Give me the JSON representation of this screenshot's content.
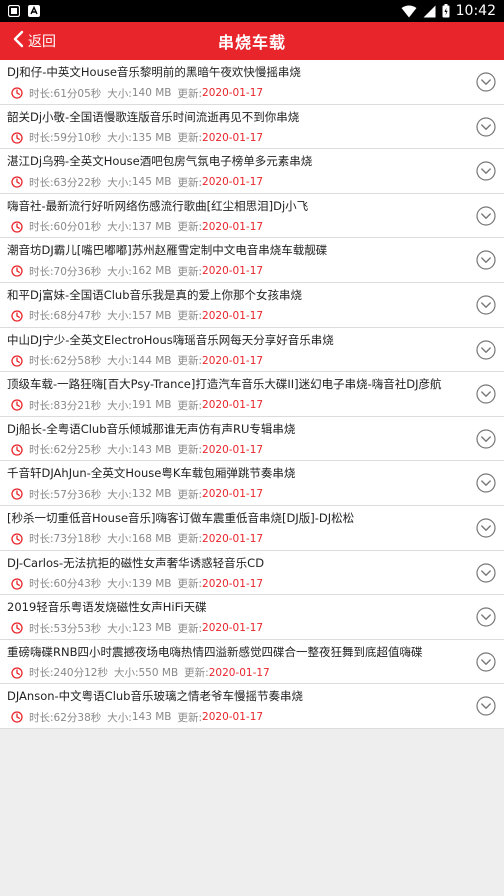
{
  "status": {
    "time": "10:42"
  },
  "header": {
    "back_label": "返回",
    "title": "串烧车载"
  },
  "labels": {
    "duration": "时长:",
    "size": "大小:",
    "updated": "更新:"
  },
  "colors": {
    "accent": "#e8252b"
  },
  "items": [
    {
      "title": "DJ和仔-中英文House音乐黎明前的黑暗午夜欢快慢摇串烧",
      "duration": "61分05秒",
      "size": "140 MB",
      "date": "2020-01-17"
    },
    {
      "title": "韶关Dj小敬-全国语慢歌连版音乐时间流逝再见不到你串烧",
      "duration": "59分10秒",
      "size": "135 MB",
      "date": "2020-01-17"
    },
    {
      "title": "湛江Dj乌鸦-全英文House酒吧包房气氛电子榜单多元素串烧",
      "duration": "63分22秒",
      "size": "145 MB",
      "date": "2020-01-17"
    },
    {
      "title": "嗨音社-最新流行好听网络伤感流行歌曲[红尘相思泪]Dj小飞",
      "duration": "60分01秒",
      "size": "137 MB",
      "date": "2020-01-17"
    },
    {
      "title": "潮音坊DJ霸儿[嘴巴嘟嘟]苏州赵雁雪定制中文电音串烧车载靓碟",
      "duration": "70分36秒",
      "size": "162 MB",
      "date": "2020-01-17"
    },
    {
      "title": "和平Dj富妹-全国语Club音乐我是真的爱上你那个女孩串烧",
      "duration": "68分47秒",
      "size": "157 MB",
      "date": "2020-01-17"
    },
    {
      "title": "中山DJ宁少-全英文ElectroHous嗨瑶音乐网每天分享好音乐串烧",
      "duration": "62分58秒",
      "size": "144 MB",
      "date": "2020-01-17"
    },
    {
      "title": "顶级车载-一路狂嗨[百大Psy-Trance]打造汽车音乐大碟II]迷幻电子串烧-嗨音社DJ彦航",
      "duration": "83分21秒",
      "size": "191 MB",
      "date": "2020-01-17"
    },
    {
      "title": "Dj船长-全粤语Club音乐倾城那谁无声仿有声RU专辑串烧",
      "duration": "62分25秒",
      "size": "143 MB",
      "date": "2020-01-17"
    },
    {
      "title": "千音轩DJAhJun-全英文House粤K车载包厢弹跳节奏串烧",
      "duration": "57分36秒",
      "size": "132 MB",
      "date": "2020-01-17"
    },
    {
      "title": "[秒杀一切重低音House音乐]嗨客订做车震重低音串烧[DJ版]-DJ松松",
      "duration": "73分18秒",
      "size": "168 MB",
      "date": "2020-01-17"
    },
    {
      "title": "DJ-Carlos-无法抗拒的磁性女声奢华诱惑轻音乐CD",
      "duration": "60分43秒",
      "size": "139 MB",
      "date": "2020-01-17"
    },
    {
      "title": "2019轻音乐粤语发烧磁性女声HiFi天碟",
      "duration": "53分53秒",
      "size": "123 MB",
      "date": "2020-01-17"
    },
    {
      "title": "重磅嗨碟RNB四小时震撼夜场电嗨热情四溢新感觉四碟合一整夜狂舞到底超值嗨碟",
      "duration": "240分12秒",
      "size": "550 MB",
      "date": "2020-01-17"
    },
    {
      "title": "DJAnson-中文粤语Club音乐玻璃之情老爷车慢摇节奏串烧",
      "duration": "62分38秒",
      "size": "143 MB",
      "date": "2020-01-17"
    }
  ]
}
